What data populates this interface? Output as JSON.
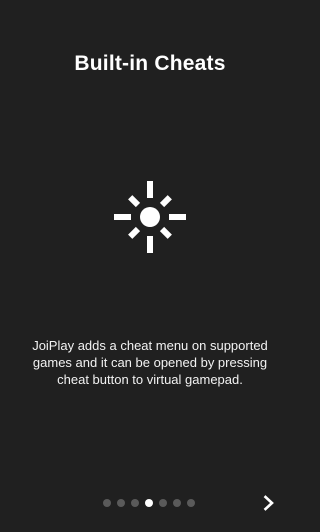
{
  "intro": {
    "title": "Built-in Cheats",
    "icon": "brightness-icon",
    "description": "JoiPlay adds a cheat menu on supported games and it can be opened by pressing cheat button to virtual gamepad."
  },
  "pager": {
    "total_pages": 7,
    "current_page": 4
  },
  "navigation": {
    "next_icon": "chevron-right-icon"
  },
  "colors": {
    "background": "#202020",
    "text": "#ffffff",
    "inactive_dot": "#5a5a5a",
    "active_dot": "#ffffff"
  }
}
